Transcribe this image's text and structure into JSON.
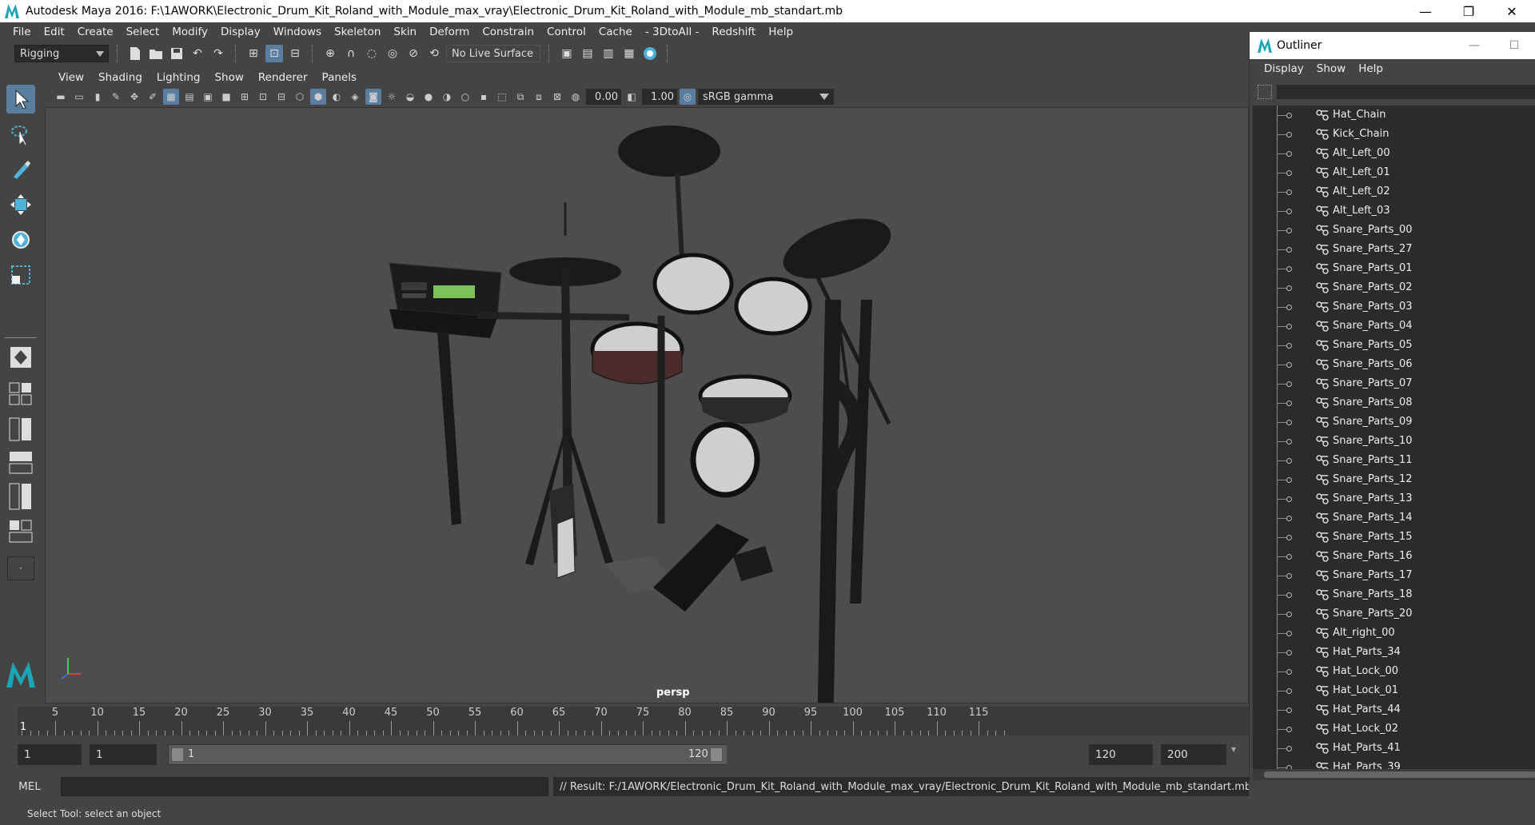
{
  "window": {
    "title": "Autodesk Maya 2016: F:\\1AWORK\\Electronic_Drum_Kit_Roland_with_Module_max_vray\\Electronic_Drum_Kit_Roland_with_Module_mb_standart.mb",
    "minimize": "—",
    "maximize": "❐",
    "close": "✕"
  },
  "menubar": [
    "File",
    "Edit",
    "Create",
    "Select",
    "Modify",
    "Display",
    "Windows",
    "Skeleton",
    "Skin",
    "Deform",
    "Constrain",
    "Control",
    "Cache",
    "- 3DtoAll -",
    "Redshift",
    "Help"
  ],
  "shelf": {
    "mode": "Rigging",
    "live_surface": "No Live Surface"
  },
  "panel": {
    "menu": [
      "View",
      "Shading",
      "Lighting",
      "Show",
      "Renderer",
      "Panels"
    ],
    "exposure": "0.00",
    "gamma_value": "1.00",
    "color_space": "sRGB gamma",
    "camera": "persp"
  },
  "timeline": {
    "ticks": [
      "5",
      "10",
      "15",
      "20",
      "25",
      "30",
      "35",
      "40",
      "45",
      "50",
      "55",
      "60",
      "65",
      "70",
      "75",
      "80",
      "85",
      "90",
      "95",
      "100",
      "105",
      "110",
      "115"
    ],
    "current_frame_marker": "1"
  },
  "range": {
    "start_time": "1",
    "playback_start": "1",
    "range_start_label": "1",
    "range_end_label": "120",
    "playback_end": "120",
    "end_time": "200"
  },
  "command": {
    "language": "MEL",
    "result": "// Result: F:/1AWORK/Electronic_Drum_Kit_Roland_with_Module_max_vray/Electronic_Drum_Kit_Roland_with_Module_mb_standart.mb"
  },
  "helpline": "Select Tool: select an object",
  "outliner": {
    "title": "Outliner",
    "menu": [
      "Display",
      "Show",
      "Help"
    ],
    "items": [
      "Hat_Chain",
      "Kick_Chain",
      "Alt_Left_00",
      "Alt_Left_01",
      "Alt_Left_02",
      "Alt_Left_03",
      "Snare_Parts_00",
      "Snare_Parts_27",
      "Snare_Parts_01",
      "Snare_Parts_02",
      "Snare_Parts_03",
      "Snare_Parts_04",
      "Snare_Parts_05",
      "Snare_Parts_06",
      "Snare_Parts_07",
      "Snare_Parts_08",
      "Snare_Parts_09",
      "Snare_Parts_10",
      "Snare_Parts_11",
      "Snare_Parts_12",
      "Snare_Parts_13",
      "Snare_Parts_14",
      "Snare_Parts_15",
      "Snare_Parts_16",
      "Snare_Parts_17",
      "Snare_Parts_18",
      "Snare_Parts_20",
      "Alt_right_00",
      "Hat_Parts_34",
      "Hat_Lock_00",
      "Hat_Lock_01",
      "Hat_Parts_44",
      "Hat_Lock_02",
      "Hat_Parts_41",
      "Hat_Parts_39"
    ]
  },
  "colors": {
    "accent": "#5a7ea0",
    "maya_teal": "#1aa6b7",
    "panel_bg": "#444444",
    "field_bg": "#2b2b2b"
  }
}
